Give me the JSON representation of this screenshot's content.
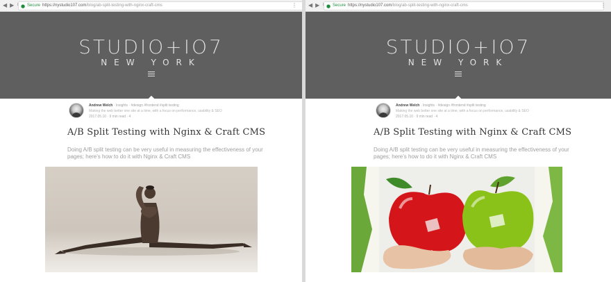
{
  "panes": {
    "left": {
      "browser": {
        "secure_label": "Secure",
        "url_host": "https://nystudio107.com",
        "url_path": "/blog/ab-split-testing-with-nginx-craft-cms"
      },
      "hero": {
        "logo_text": "STUDIO+IO7",
        "logo_city": "NEW YORK"
      },
      "post": {
        "author": "Andrew Welch",
        "meta_topics": " · Insights · #design #frontend #split testing",
        "tagline": "Making the web better one site at a time, with a focus on performance, usability & SEO",
        "date_meta": "2017.05.10 · 9 min read · 4",
        "title": "A/B Split Testing with Nginx & Craft CMS",
        "subtitle": "Doing A/B split testing can be very useful in measuring the effectiveness of your pages; here's how to do it with Nginx & Craft CMS"
      },
      "image": {
        "subject": "dancer in split pose"
      }
    },
    "right": {
      "browser": {
        "secure_label": "Secure",
        "url_host": "https://nystudio107.com",
        "url_path": "/blog/ab-split-testing-with-nginx-craft-cms"
      },
      "hero": {
        "logo_text": "STUDIO+IO7",
        "logo_city": "NEW YORK"
      },
      "post": {
        "author": "Andrew Welch",
        "meta_topics": " · Insights · #design #frontend #split testing",
        "tagline": "Making the web better one site at a time, with a focus on performance, usability & SEO",
        "date_meta": "2017.05.10 · 9 min read · 4",
        "title": "A/B Split Testing with Nginx & Craft CMS",
        "subtitle": "Doing A/B split testing can be very useful in measuring the effectiveness of your pages; here's how to do it with Nginx & Craft CMS"
      },
      "image": {
        "subject": "hands holding a red apple and a green apple"
      }
    }
  },
  "colors": {
    "hero_background": "#5f5f5f",
    "logo": "#ececec",
    "secure": "#1e8e3e",
    "apple_red": "#d4161a",
    "apple_green": "#8bc21a"
  },
  "icons": {
    "nav": [
      "back-icon",
      "forward-icon",
      "reload-icon"
    ],
    "secure": "lock-icon",
    "menu": "hamburger-menu-icon",
    "browser_menu": "browser-menu-icon"
  }
}
